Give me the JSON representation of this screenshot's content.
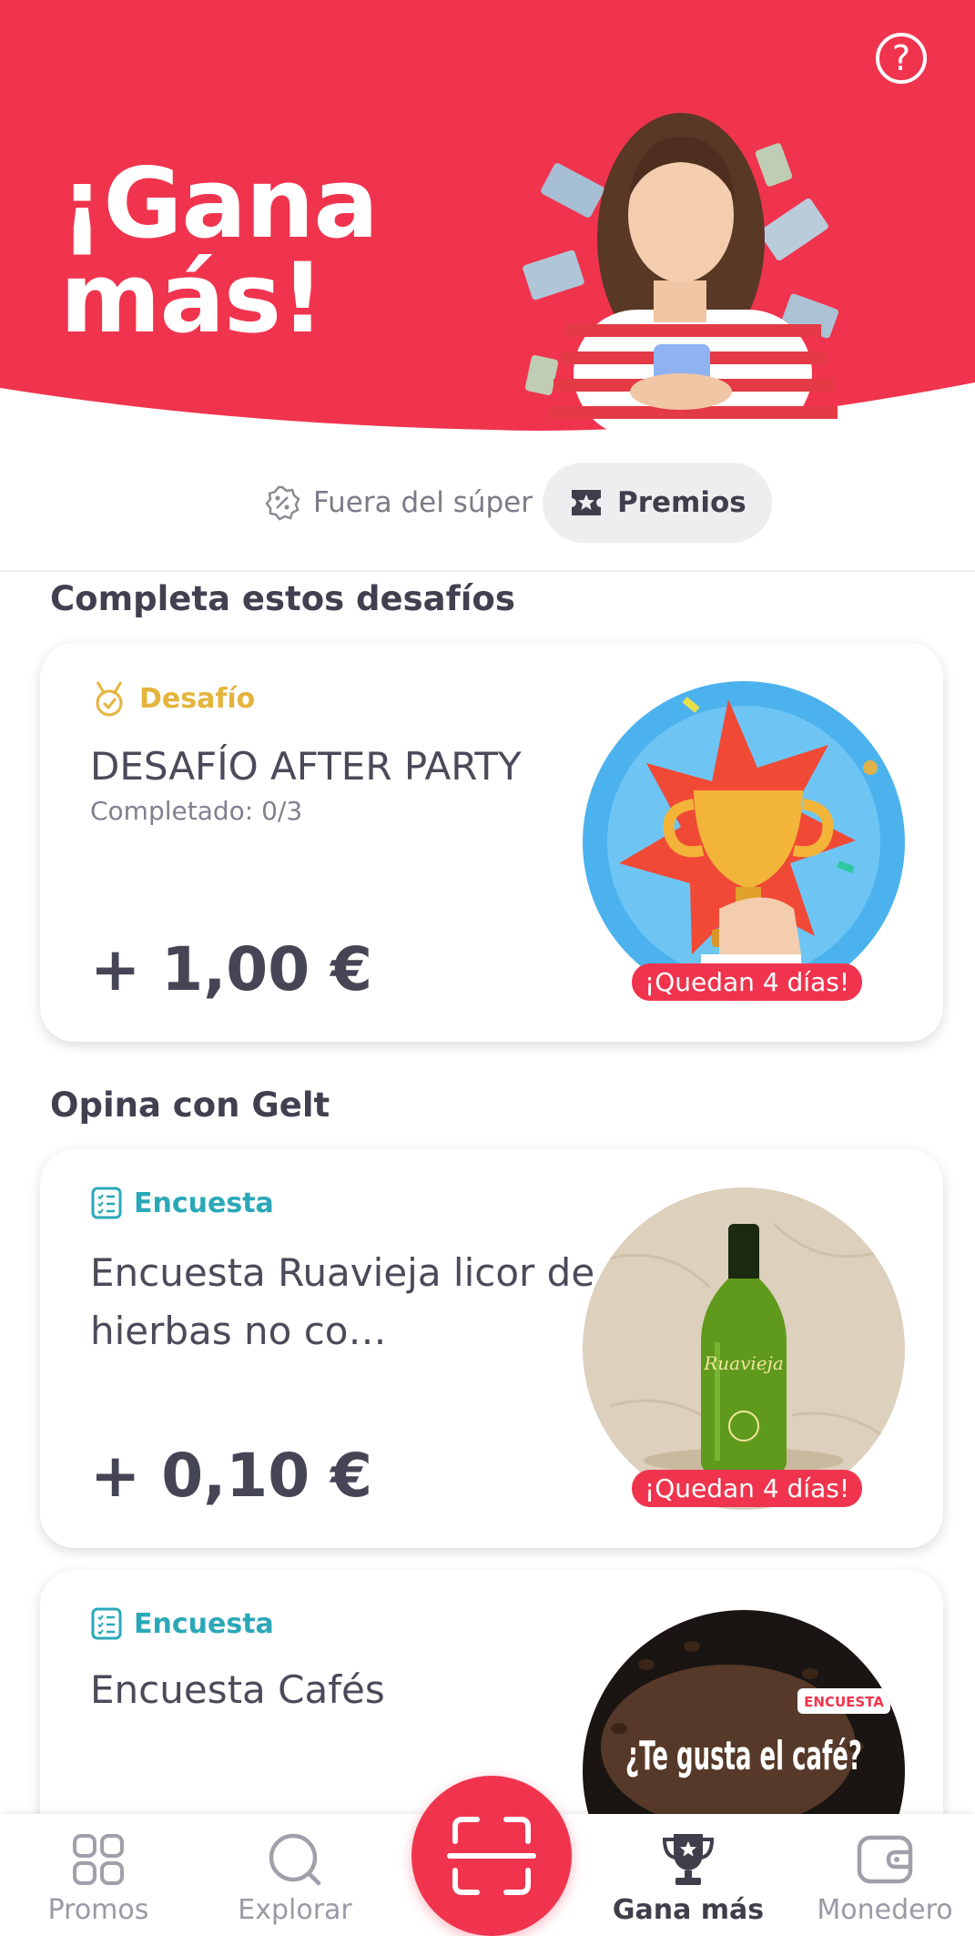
{
  "colors": {
    "brand": "#f0344e",
    "challenge_tag": "#e5b43c",
    "survey_tag": "#2aa8b8"
  },
  "hero": {
    "title": "¡Gana más!",
    "help_icon": "help-circle-icon"
  },
  "tabs": [
    {
      "label": "Fuera del súper",
      "icon": "percent-badge-icon",
      "selected": false
    },
    {
      "label": "Premios",
      "icon": "ticket-star-icon",
      "selected": true
    }
  ],
  "sections": {
    "challenges": {
      "title": "Completa estos desafíos",
      "cards": [
        {
          "tag": "Desafío",
          "tag_icon": "medal-icon",
          "title": "DESAFÍO AFTER PARTY",
          "subtitle": "Completado: 0/3",
          "amount": "+ 1,00 €",
          "badge": "¡Quedan 4 días!",
          "image": "trophy-image"
        }
      ]
    },
    "surveys": {
      "title": "Opina con Gelt",
      "cards": [
        {
          "tag": "Encuesta",
          "tag_icon": "survey-list-icon",
          "title": "Encuesta Ruavieja licor de hierbas no co…",
          "amount": "+ 0,10 €",
          "badge": "¡Quedan 4 días!",
          "image": "liqueur-bottle-image",
          "image_text": "Ruavieja"
        },
        {
          "tag": "Encuesta",
          "tag_icon": "survey-list-icon",
          "title": "Encuesta Cafés",
          "image": "coffee-image",
          "image_label": "ENCUESTA",
          "image_text": "¿Te gusta el café?"
        }
      ]
    }
  },
  "bottom_nav": {
    "items": [
      {
        "label": "Promos",
        "icon": "grid-icon",
        "active": false
      },
      {
        "label": "Explorar",
        "icon": "search-icon",
        "active": false
      },
      {
        "label": "Gana más",
        "icon": "trophy-icon",
        "active": true
      },
      {
        "label": "Monedero",
        "icon": "wallet-icon",
        "active": false
      }
    ],
    "scan_icon": "scan-icon"
  }
}
